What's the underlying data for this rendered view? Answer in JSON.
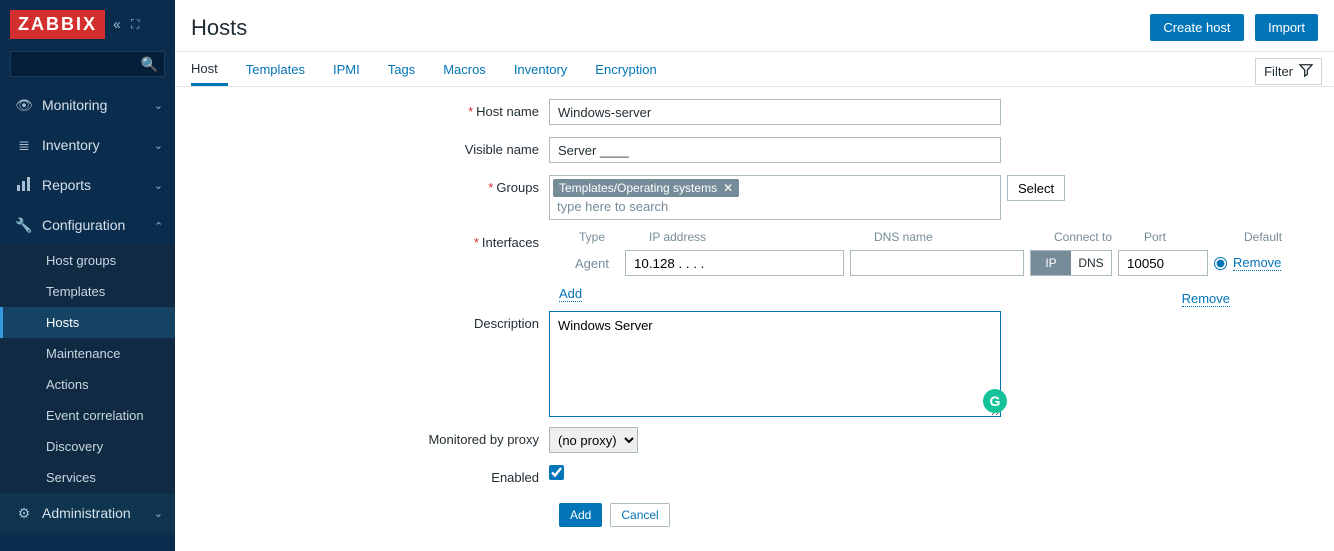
{
  "brand": "ZABBIX",
  "sidebar": {
    "items": [
      {
        "icon": "👁",
        "label": "Monitoring",
        "expanded": false
      },
      {
        "icon": "≣",
        "label": "Inventory",
        "expanded": false
      },
      {
        "icon": "▮▮",
        "label": "Reports",
        "expanded": false
      },
      {
        "icon": "🔧",
        "label": "Configuration",
        "expanded": true
      },
      {
        "icon": "⚙",
        "label": "Administration",
        "expanded": false
      }
    ],
    "config_sub": [
      {
        "label": "Host groups"
      },
      {
        "label": "Templates"
      },
      {
        "label": "Hosts",
        "active": true
      },
      {
        "label": "Maintenance"
      },
      {
        "label": "Actions"
      },
      {
        "label": "Event correlation"
      },
      {
        "label": "Discovery"
      },
      {
        "label": "Services"
      }
    ]
  },
  "header": {
    "title": "Hosts",
    "create_btn": "Create host",
    "import_btn": "Import"
  },
  "tabs": [
    {
      "label": "Host",
      "active": true
    },
    {
      "label": "Templates"
    },
    {
      "label": "IPMI"
    },
    {
      "label": "Tags"
    },
    {
      "label": "Macros"
    },
    {
      "label": "Inventory"
    },
    {
      "label": "Encryption"
    }
  ],
  "filter_label": "Filter",
  "form": {
    "host_name_label": "Host name",
    "host_name_value": "Windows-server",
    "visible_name_label": "Visible name",
    "visible_name_value": "Server ____",
    "groups_label": "Groups",
    "group_tag": "Templates/Operating systems",
    "group_placeholder": "type here to search",
    "select_btn": "Select",
    "interfaces_label": "Interfaces",
    "iface_cols": {
      "type": "Type",
      "ip": "IP address",
      "dns": "DNS name",
      "connect": "Connect to",
      "port": "Port",
      "default": "Default"
    },
    "iface_type": "Agent",
    "ip_value": "10.128 . . . .",
    "dns_value": "",
    "connect_ip": "IP",
    "connect_dns": "DNS",
    "port_value": "10050",
    "remove_link": "Remove",
    "add_link": "Add",
    "description_label": "Description",
    "description_value": "Windows Server ",
    "proxy_label": "Monitored by proxy",
    "proxy_value": "(no proxy)",
    "enabled_label": "Enabled",
    "enabled_checked": true,
    "add_btn": "Add",
    "cancel_btn": "Cancel"
  },
  "side_remove": "Remove"
}
